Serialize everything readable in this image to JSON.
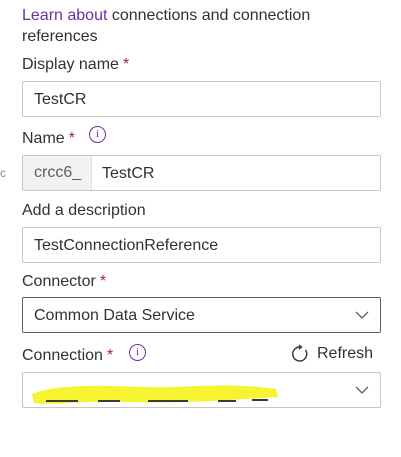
{
  "learn": {
    "link_text": "Learn about",
    "rest_text": " connections and connection references"
  },
  "display_name": {
    "label": "Display name",
    "required_mark": "*",
    "value": "TestCR"
  },
  "name": {
    "label": "Name",
    "required_mark": "*",
    "info_icon": "info-icon",
    "prefix": "crcc6_",
    "value": "TestCR"
  },
  "description": {
    "label": "Add a description",
    "value": "TestConnectionReference"
  },
  "connector": {
    "label": "Connector",
    "required_mark": "*",
    "selected": "Common Data Service"
  },
  "connection": {
    "label": "Connection",
    "required_mark": "*",
    "info_icon": "info-icon",
    "refresh_label": "Refresh",
    "selected": ""
  },
  "colors": {
    "link": "#6b2fa0",
    "required": "#a4262c",
    "highlighter": "#f5f21a"
  }
}
